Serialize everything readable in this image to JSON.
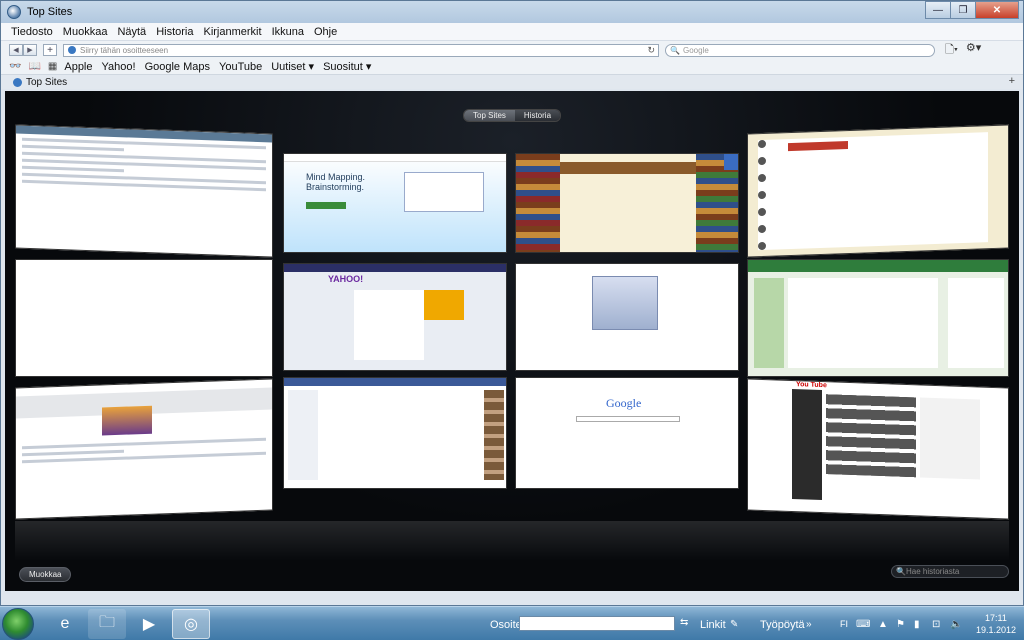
{
  "window": {
    "title": "Top Sites",
    "buttons": {
      "minimize": "—",
      "maximize": "❐",
      "close": "✕"
    }
  },
  "menubar": [
    "Tiedosto",
    "Muokkaa",
    "Näytä",
    "Historia",
    "Kirjanmerkit",
    "Ikkuna",
    "Ohje"
  ],
  "toolbar": {
    "address_placeholder": "Siirry tähän osoitteeseen",
    "search_placeholder": "Google",
    "back_icon": "◀",
    "forward_icon": "▶",
    "add_icon": "+",
    "reload_icon": "↻",
    "page_menu_icon": "🗋▾",
    "settings_icon": "⚙▾"
  },
  "bookmarks": {
    "icons": [
      "👓",
      "📖",
      "▦"
    ],
    "items": [
      "Apple",
      "Yahoo!",
      "Google Maps",
      "YouTube",
      "Uutiset ▾",
      "Suositut ▾"
    ]
  },
  "tab": {
    "label": "Top Sites",
    "new_tab_icon": "+"
  },
  "topsites": {
    "segment": [
      "Top Sites",
      "Historia"
    ],
    "edit_button": "Muokkaa",
    "history_search_placeholder": "Hae historiasta",
    "thumbs": [
      {
        "name": "news-site",
        "accent": "#d9e2ea"
      },
      {
        "name": "mindmeister",
        "accent": "#5aa9e0",
        "text": "Mind Mapping. Brainstorming."
      },
      {
        "name": "bookshelf-blog",
        "accent": "#8a5a2b"
      },
      {
        "name": "notebook-blog",
        "accent": "#efe6c8"
      },
      {
        "name": "blank",
        "accent": "#ffffff"
      },
      {
        "name": "yahoo",
        "accent": "#6b2aa0",
        "text": "YAHOO!"
      },
      {
        "name": "login-page",
        "accent": "#b7c3d6"
      },
      {
        "name": "green-site",
        "accent": "#2f7d3c"
      },
      {
        "name": "portal",
        "accent": "#e5e7ea"
      },
      {
        "name": "facebook",
        "accent": "#3b5998"
      },
      {
        "name": "google",
        "accent": "#ffffff",
        "text": "Google"
      },
      {
        "name": "youtube",
        "accent": "#2b2b2b",
        "text": "You Tube"
      }
    ]
  },
  "taskbar": {
    "address_label": "Osoite",
    "links_label": "Linkit",
    "desktop_label": "Työpöytä",
    "lang": "FI",
    "time": "17:11",
    "date": "19.1.2012"
  }
}
